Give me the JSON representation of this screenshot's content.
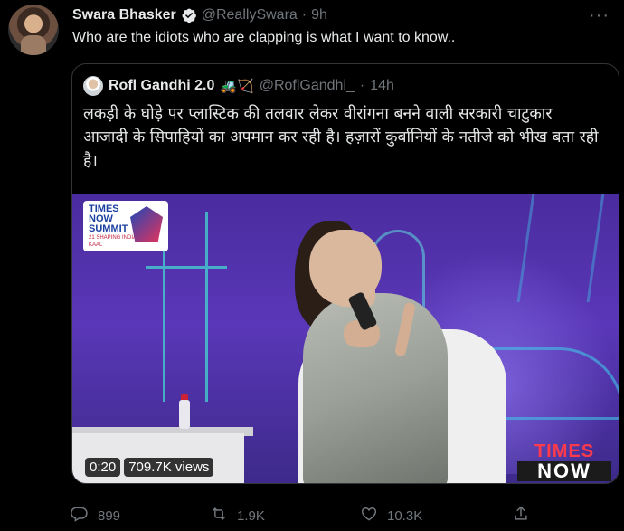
{
  "tweet": {
    "name": "Swara Bhasker",
    "handle": "@ReallySwara",
    "separator": "·",
    "time": "9h",
    "more_label": "···",
    "text": "Who are the idiots who are clapping is what I want to know.."
  },
  "quote": {
    "name": "Rofl Gandhi 2.0",
    "emojis": "🚜🏹",
    "handle": "@RoflGandhi_",
    "separator": "·",
    "time": "14h",
    "text": "लकड़ी के घोड़े पर प्लास्टिक की तलवार लेकर वीरांगना बनने वाली सरकारी चाटुकार आजादी के सिपाहियों का अपमान कर रही है। हज़ारों कुर्बानियों के नतीजे को भीख बता रही है।",
    "video": {
      "duration": "0:20",
      "views": "709.7K views",
      "logo_lines": [
        "TIMES",
        "NOW",
        "SUMMIT"
      ],
      "logo_sub": "21 SHAPING INDIA'S AMRIT KAAL",
      "channel_top": "TIMES",
      "channel_bottom": "NOW"
    }
  },
  "actions": {
    "reply_count": "899",
    "retweet_count": "1.9K",
    "like_count": "10.3K"
  },
  "colors": {
    "background": "#000000",
    "text": "#e7e9ea",
    "muted": "#71767b",
    "verified": "#1d9bf0",
    "border": "#333639"
  }
}
